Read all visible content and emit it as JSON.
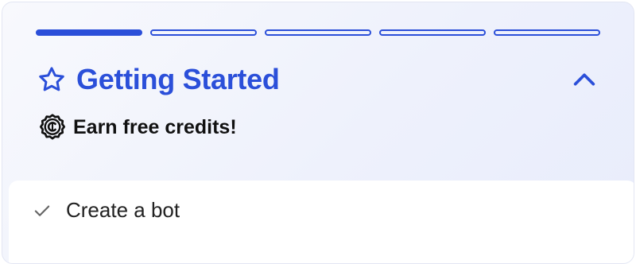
{
  "colors": {
    "accent": "#2b4fd9",
    "text": "#111111",
    "muted": "#666666"
  },
  "progress": {
    "total_steps": 5,
    "completed_steps": 1
  },
  "header": {
    "icon": "star-icon",
    "title": "Getting Started",
    "toggle_icon": "chevron-up-icon",
    "expanded": true
  },
  "credits": {
    "icon": "credit-coin-icon",
    "text": "Earn free credits!"
  },
  "tasks": [
    {
      "label": "Create a bot",
      "icon": "checkmark-icon",
      "completed": true
    }
  ]
}
